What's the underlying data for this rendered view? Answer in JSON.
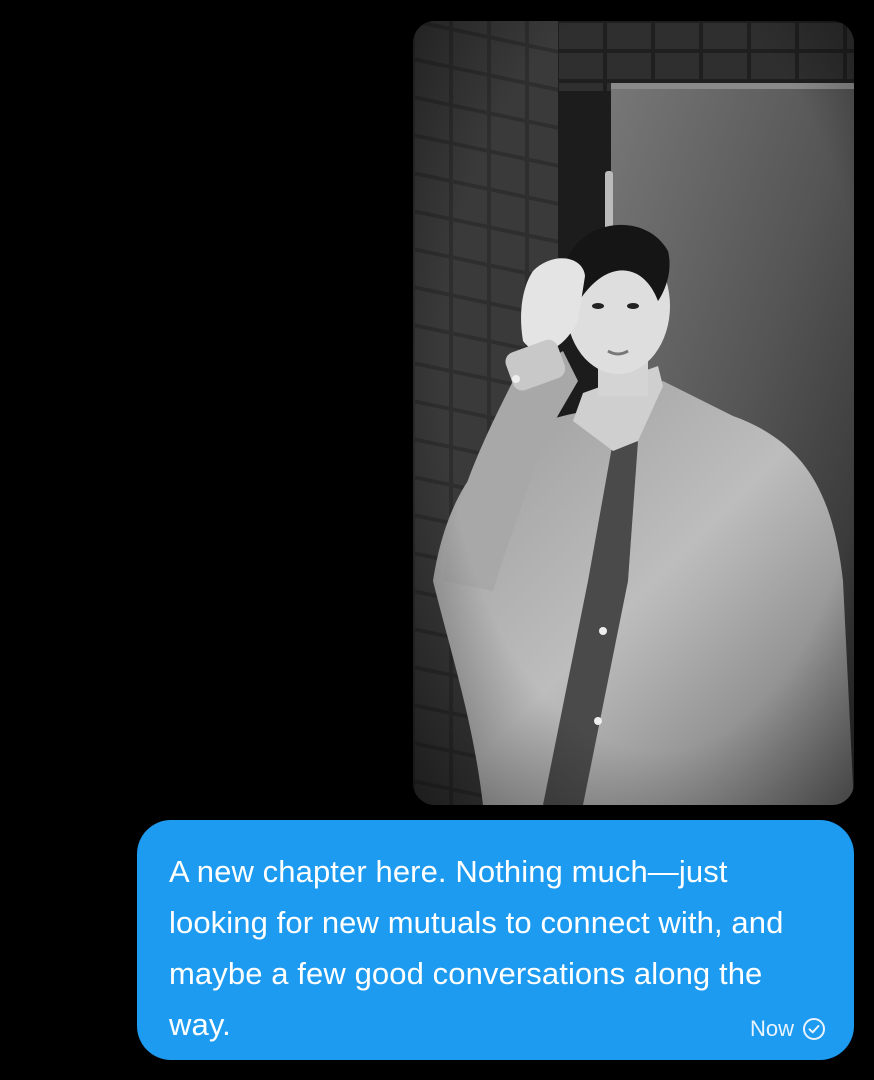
{
  "conversation": {
    "messages": [
      {
        "type": "image",
        "icon": "photo-of-person-in-shirt-and-tie"
      },
      {
        "type": "text",
        "text": "A new chapter here. Nothing much—just looking for new mutuals to connect with, and maybe a few good conversations along the way.",
        "time": "Now",
        "status_icon": "check-circle-icon"
      }
    ]
  },
  "colors": {
    "background": "#000000",
    "bubble": "#1d9bf0",
    "bubble_text": "#ffffff"
  }
}
